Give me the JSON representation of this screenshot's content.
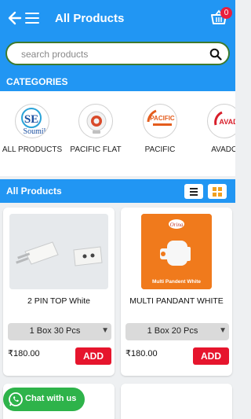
{
  "header": {
    "title": "All Products",
    "cart_count": "0"
  },
  "search": {
    "placeholder": "search products"
  },
  "categories": {
    "title": "CATEGORIES",
    "items": [
      {
        "label": "ALL PRODUCTS",
        "logo_text": "Soumil"
      },
      {
        "label": "PACIFIC FLAT"
      },
      {
        "label": "PACIFIC",
        "logo_text": "PACIFIC"
      },
      {
        "label": "AVADO",
        "logo_text": "AVADO"
      }
    ]
  },
  "products": {
    "title": "All Products",
    "items": [
      {
        "name": "2 PIN TOP White",
        "pack": "1 Box 30 Pcs",
        "price": "₹180.00",
        "add_label": "ADD"
      },
      {
        "name": "MULTI PANDANT WHITE",
        "pack": "1 Box 20 Pcs",
        "price": "₹180.00",
        "add_label": "ADD",
        "image_caption": "Multi Pandent White",
        "image_brand": "Orina"
      }
    ]
  },
  "chat": {
    "label": "Chat with us"
  },
  "colors": {
    "primary": "#2196f3",
    "add_button": "#e6152d",
    "chat": "#2eb34a",
    "search_border": "#3d7a2e",
    "grid_toggle": "#f0a020"
  }
}
